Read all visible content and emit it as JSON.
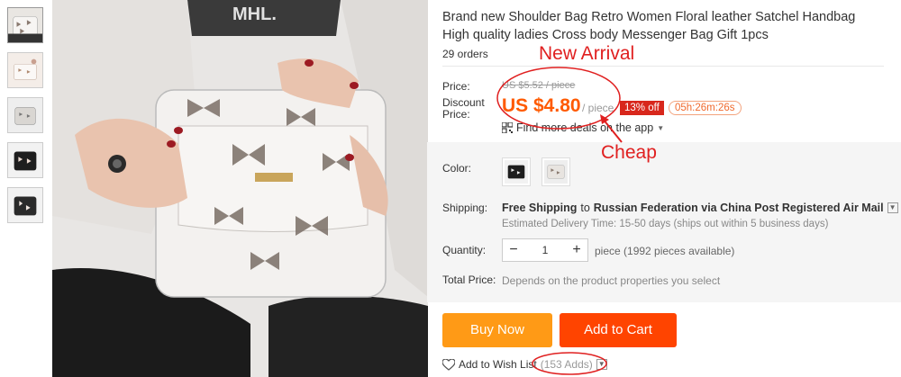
{
  "product": {
    "title": "Brand new Shoulder Bag Retro Women Floral leather Satchel Handbag High quality ladies Cross body Messenger Bag Gift 1pcs",
    "orders": "29 orders"
  },
  "price": {
    "label": "Price:",
    "original": "US $5.52 / piece",
    "discount_label_line1": "Discount",
    "discount_label_line2": "Price:",
    "current": "US $4.80",
    "unit": "/ piece",
    "off_badge": "13% off",
    "countdown": "05h:26m:26s",
    "deals_link": "Find more deals on the app"
  },
  "color": {
    "label": "Color:"
  },
  "shipping": {
    "label": "Shipping:",
    "free": "Free Shipping",
    "to": "to",
    "destination": "Russian Federation via China Post Registered Air Mail",
    "estimate": "Estimated Delivery Time: 15-50 days (ships out within 5 business days)"
  },
  "quantity": {
    "label": "Quantity:",
    "minus": "−",
    "value": "1",
    "plus": "+",
    "note": "piece (1992 pieces available)"
  },
  "total": {
    "label": "Total Price:",
    "note": "Depends on the product properties you select"
  },
  "actions": {
    "buy_now": "Buy Now",
    "add_to_cart": "Add to Cart",
    "wishlist": "Add to Wish List",
    "wishlist_count": "(153 Adds)"
  },
  "annotations": {
    "new_arrival": "New Arrival",
    "cheap": "Cheap"
  },
  "colors": {
    "accent_orange": "#ff5a00",
    "buy_now": "#ff9a16",
    "add_to_cart": "#ff4400",
    "annotation_red": "#e02020"
  }
}
